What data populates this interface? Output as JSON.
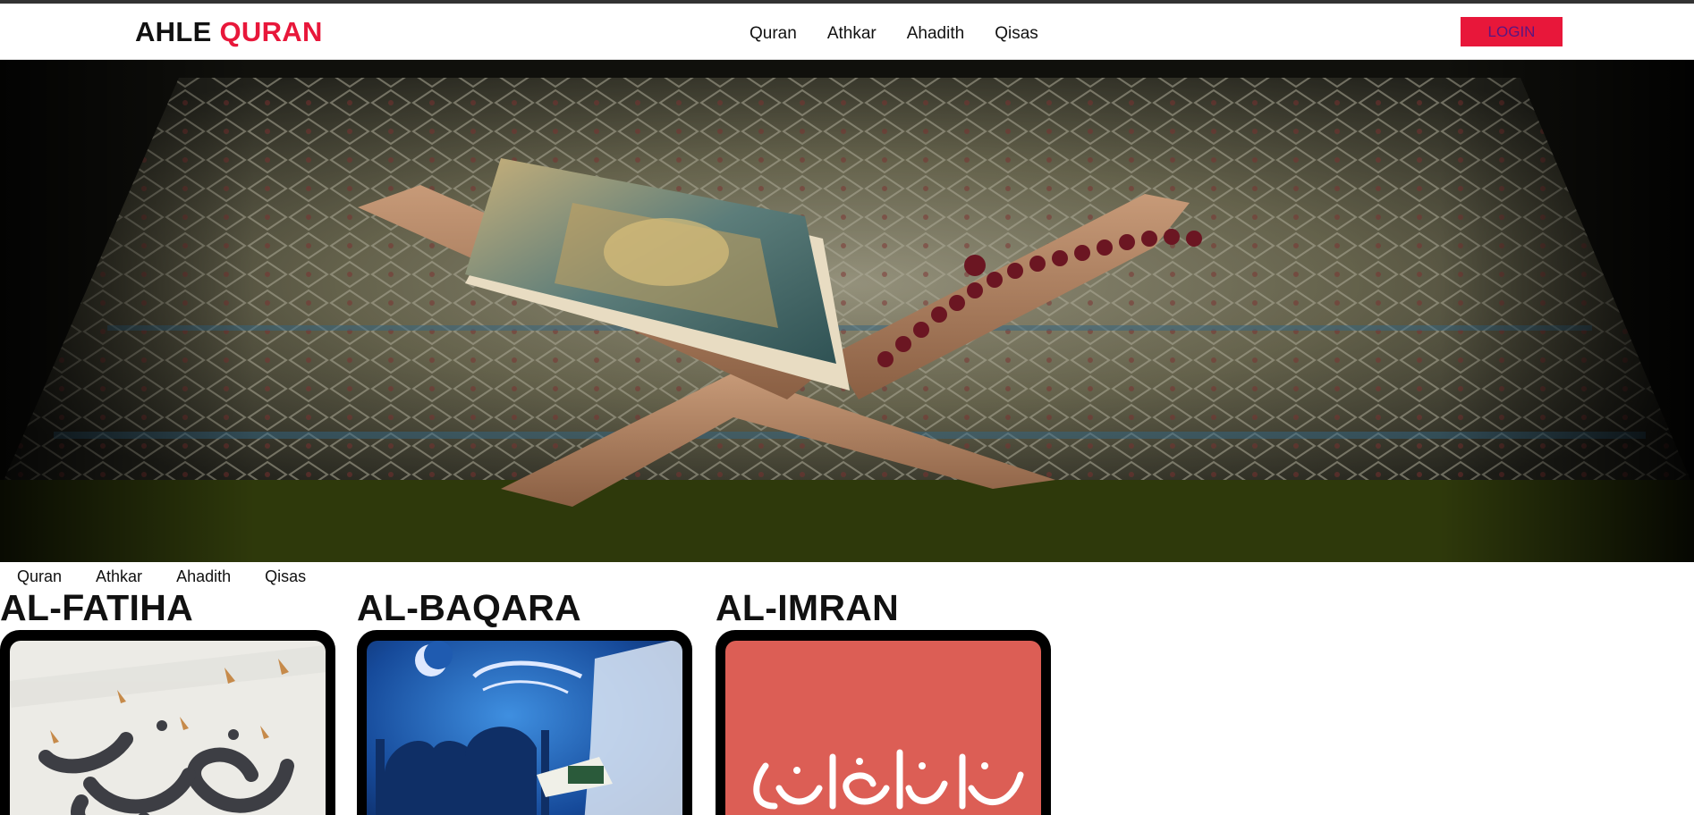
{
  "header": {
    "logo_part1": "AHLE",
    "logo_part2": "QURAN",
    "nav": [
      "Quran",
      "Athkar",
      "Ahadith",
      "Qisas"
    ],
    "login_label": "LOGIN"
  },
  "subnav": [
    "Quran",
    "Athkar",
    "Ahadith",
    "Qisas"
  ],
  "cards": [
    {
      "title": "AL-FATIHA",
      "image": "surah-al-fatiha-calligraphy"
    },
    {
      "title": "AL-BAQARA",
      "image": "surah-al-baqara-mosque-night"
    },
    {
      "title": "AL-IMRAN",
      "image": "surah-al-imran-calligraphy"
    }
  ],
  "hero": {
    "image": "quran-on-wooden-stand-with-prayer-beads"
  },
  "colors": {
    "accent": "#e8173a",
    "text": "#111111",
    "login_text": "#5a1680"
  }
}
